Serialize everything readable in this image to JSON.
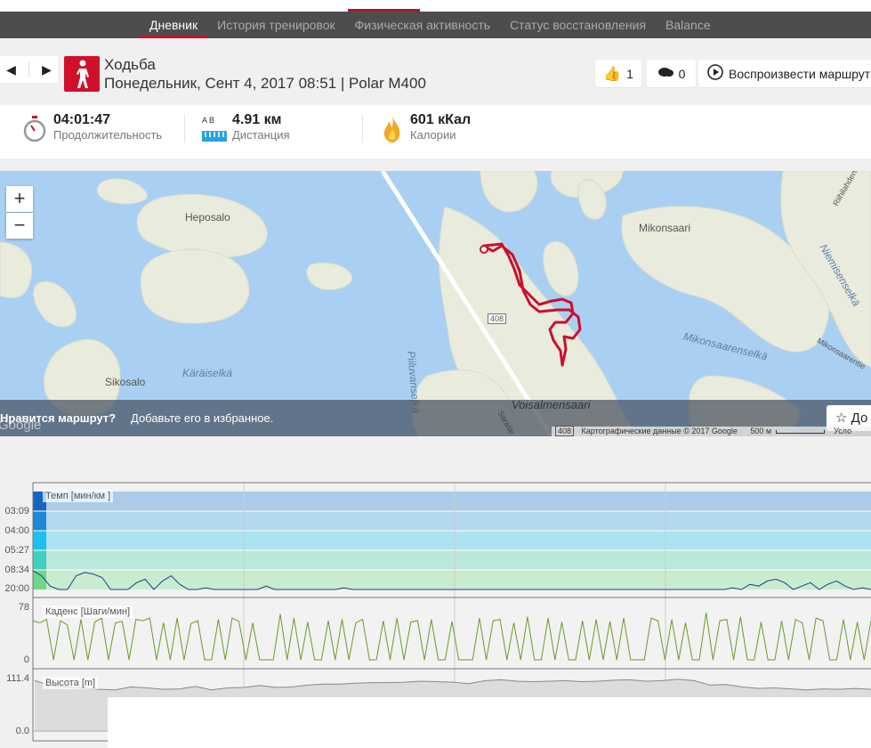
{
  "nav": {
    "tabs": [
      "Дневник",
      "История тренировок",
      "Физическая активность",
      "Статус восстановления",
      "Balance"
    ],
    "active": 0
  },
  "activity": {
    "sport": "Ходьба",
    "subtitle": "Понедельник, Сент 4, 2017 08:51 | Polar M400",
    "likes": "1",
    "comments": "0",
    "replay_label": "Воспроизвести маршрут"
  },
  "stats": {
    "duration_value": "04:01:47",
    "duration_label": "Продолжительность",
    "distance_ab": "A  B",
    "distance_value": "4.91 км",
    "distance_label": "Дистанция",
    "calories_value": "601 кКал",
    "calories_label": "Калории"
  },
  "map": {
    "places": [
      "Heposalo",
      "Mikonsaari",
      "Sikosalo",
      "Käräiselkä",
      "Piiluvanselkä",
      "Voisalmensaari",
      "Mikonsaarenselkä",
      "Niemisenselkä",
      "Mikonsaarentie",
      "Riihilahdentie",
      "Saratie"
    ],
    "road": "408",
    "zoom_in": "+",
    "zoom_out": "−",
    "favorite_question": "Нравится маршрут?",
    "favorite_hint": "Добавьте его в избранное.",
    "favorite_button": "До",
    "attribution": "Картографические данные © 2017 Google",
    "scale": "500 м",
    "terms": "Усло",
    "google": "Google",
    "route_color": "#c8102e"
  },
  "chart_data": [
    {
      "type": "area",
      "title": "Темп [мин/км ]",
      "ytick_labels": [
        "03:09",
        "04:00",
        "05:27",
        "08:34",
        "20:00"
      ],
      "values": [
        9,
        12,
        18,
        20,
        20,
        12,
        10,
        11,
        13,
        20,
        20,
        20,
        16,
        14,
        20,
        15,
        12,
        17,
        20,
        20,
        19,
        20,
        20,
        20,
        20,
        20,
        20,
        18,
        20,
        20,
        20,
        20,
        20,
        20,
        20,
        20,
        19,
        20,
        20,
        20,
        20,
        20,
        20,
        20,
        20,
        20,
        20,
        20,
        20,
        20,
        20,
        20,
        20,
        20,
        20,
        20,
        20,
        20,
        20,
        20,
        20,
        20,
        20,
        20,
        20,
        20,
        20,
        20,
        20,
        20,
        20,
        20,
        20,
        20,
        20,
        20,
        20,
        20,
        20,
        20,
        20,
        19,
        20,
        17,
        18,
        15,
        14,
        16,
        20,
        18,
        16,
        20,
        17,
        15,
        18,
        20,
        19,
        20
      ]
    },
    {
      "type": "line",
      "title": "Каденс [Шаги/мин]",
      "ylim": [
        0,
        78
      ],
      "ytick_labels": [
        "78",
        "0"
      ],
      "values": [
        58,
        55,
        60,
        0,
        58,
        52,
        0,
        60,
        0,
        56,
        62,
        0,
        55,
        57,
        0,
        60,
        58,
        62,
        0,
        55,
        0,
        62,
        0,
        54,
        58,
        0,
        0,
        60,
        0,
        62,
        57,
        0,
        55,
        0,
        0,
        0,
        68,
        0,
        62,
        0,
        56,
        0,
        0,
        58,
        0,
        60,
        0,
        55,
        60,
        0,
        0,
        58,
        0,
        62,
        0,
        56,
        58,
        0,
        60,
        0,
        0,
        57,
        0,
        0,
        0,
        62,
        0,
        58,
        60,
        0,
        55,
        0,
        64,
        0,
        0,
        62,
        0,
        56,
        0,
        0,
        58,
        0,
        60,
        0,
        57,
        0,
        62,
        0,
        0,
        0,
        62,
        58,
        0,
        60,
        0,
        55,
        0,
        0,
        70,
        0,
        58,
        60,
        0,
        64,
        0,
        0,
        56,
        0,
        0,
        58,
        0,
        60,
        55,
        0,
        62,
        58,
        0,
        0,
        60,
        0,
        56,
        0,
        58
      ]
    },
    {
      "type": "area",
      "title": "Высота [m]",
      "ylim": [
        0,
        111.4
      ],
      "ytick_labels": [
        "111.4",
        "0.0"
      ],
      "values": [
        105,
        95,
        92,
        90,
        87,
        86,
        92,
        90,
        87,
        88,
        93,
        86,
        90,
        91,
        95,
        91,
        92,
        96,
        98,
        98,
        100,
        101,
        101,
        102,
        104,
        103,
        102,
        99,
        105,
        107,
        104,
        103,
        104,
        105,
        103,
        104,
        106,
        107,
        104,
        105,
        108,
        105,
        96,
        97,
        92,
        89,
        90,
        88,
        86,
        88,
        87,
        89,
        87
      ]
    }
  ]
}
